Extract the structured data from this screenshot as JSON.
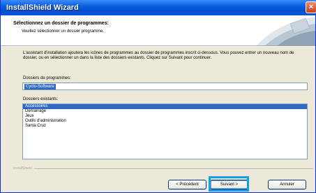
{
  "window": {
    "title": "InstallShield Wizard",
    "close_glyph": "×"
  },
  "header": {
    "title": "Sélectionnez un dossier de programmes:",
    "subtitle": "Veuillez sélectionner un dossier programme."
  },
  "body": {
    "description": "L'assistant d'installation ajoutera les icônes de programmes au dossier de programmes inscrit ci-dessous. Vous pouvez entrer un nouveau nom de dossier, ou en sélectionner un dans la liste des dossiers existants. Cliquez sur Suivant pour continuer.",
    "program_folder_label": "Dossiers de programmes:",
    "program_folder_value": "Cyclo-Software",
    "existing_folders_label": "Dossiers existants:",
    "existing_folders": [
      "Accessoires",
      "Démarrage",
      "Jeux",
      "Outils d'administration",
      "Santa Cruz"
    ],
    "selected_folder_index": 0
  },
  "footer": {
    "brand": "InstallShield",
    "back_button": {
      "label": "< Précédent"
    },
    "next_button": {
      "label": "Suivant >"
    },
    "cancel_button": {
      "label": "Annuler"
    }
  },
  "colors": {
    "titlebar": "#0a5fe0",
    "selection": "#316ac5",
    "focus_highlight": "#14a0e8"
  }
}
